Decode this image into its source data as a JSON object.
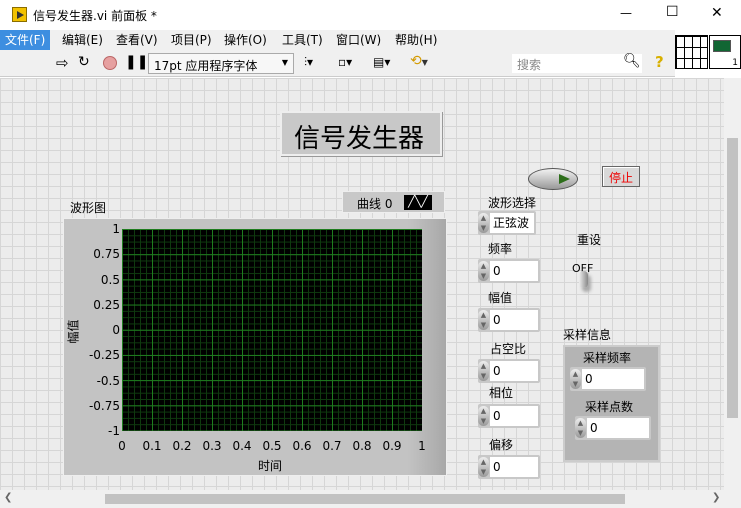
{
  "window": {
    "title": "信号发生器.vi 前面板 *",
    "minimize": "—",
    "maximize": "☐",
    "close": "✕"
  },
  "menu": [
    "文件(F)",
    "编辑(E)",
    "查看(V)",
    "项目(P)",
    "操作(O)",
    "工具(T)",
    "窗口(W)",
    "帮助(H)"
  ],
  "toolbar": {
    "font": "17pt 应用程序字体",
    "search_placeholder": "搜索",
    "help": "?",
    "connector_number": "1"
  },
  "panel": {
    "title": "信号发生器",
    "stop_label": "停止",
    "graph": {
      "label": "波形图",
      "legend": "曲线 0",
      "xlabel": "时间",
      "ylabel": "幅值"
    },
    "controls": [
      {
        "label": "波形选择",
        "value": "正弦波"
      },
      {
        "label": "频率",
        "value": "0"
      },
      {
        "label": "幅值",
        "value": "0"
      },
      {
        "label": "占空比",
        "value": "0"
      },
      {
        "label": "相位",
        "value": "0"
      },
      {
        "label": "偏移",
        "value": "0"
      }
    ],
    "reset": {
      "label": "重设",
      "state": "OFF"
    },
    "sampling": {
      "label": "采样信息",
      "rate_label": "采样频率",
      "rate": "0",
      "count_label": "采样点数",
      "count": "0"
    }
  },
  "chart_data": {
    "type": "line",
    "title": "波形图",
    "xlabel": "时间",
    "ylabel": "幅值",
    "xlim": [
      0,
      1
    ],
    "ylim": [
      -1,
      1
    ],
    "xticks": [
      "0",
      "0.1",
      "0.2",
      "0.3",
      "0.4",
      "0.5",
      "0.6",
      "0.7",
      "0.8",
      "0.9",
      "1"
    ],
    "yticks": [
      "1",
      "0.75",
      "0.5",
      "0.25",
      "0",
      "-0.25",
      "-0.5",
      "-0.75",
      "-1"
    ],
    "series": [
      {
        "name": "曲线 0",
        "values": []
      }
    ],
    "grid": true,
    "legend": "top-right"
  }
}
